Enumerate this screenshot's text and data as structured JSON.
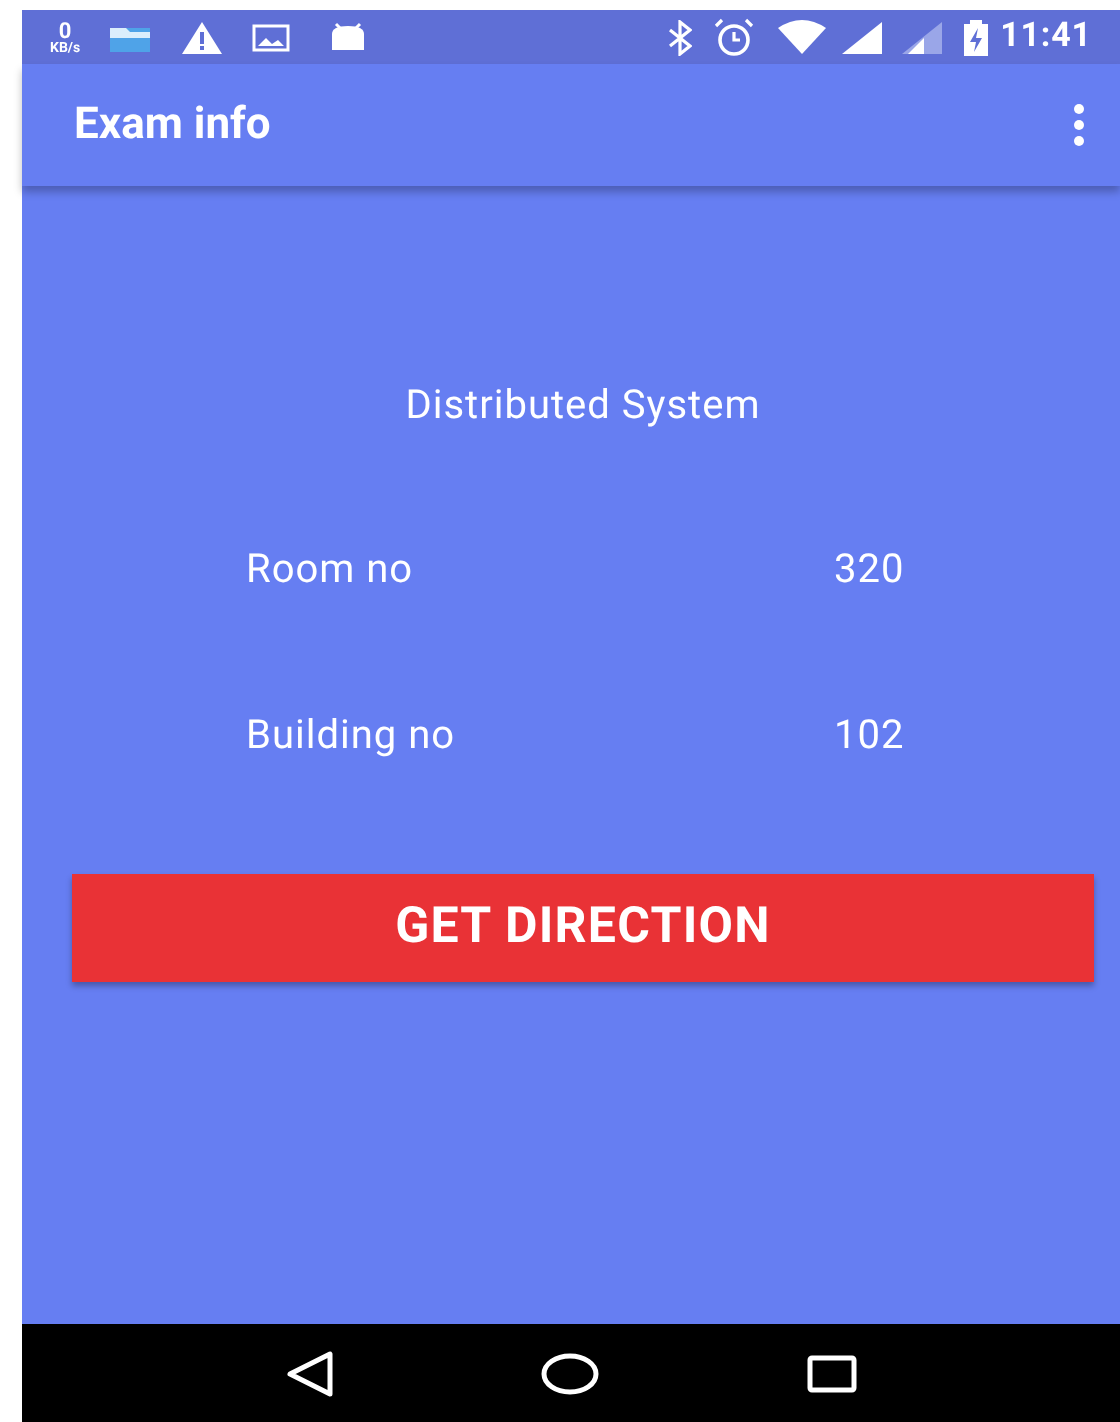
{
  "status_bar": {
    "speed_value": "0",
    "speed_unit": "KB/s",
    "time": "11:41"
  },
  "app_bar": {
    "title": "Exam info"
  },
  "exam": {
    "subject": "Distributed System",
    "details": [
      {
        "label": "Room no",
        "value": "320"
      },
      {
        "label": "Building no",
        "value": "102"
      }
    ]
  },
  "button": {
    "label": "GET DIRECTION"
  }
}
